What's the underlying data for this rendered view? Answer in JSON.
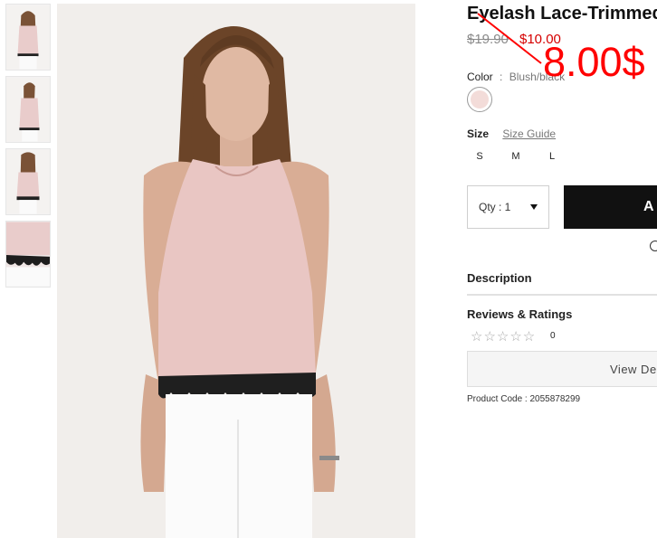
{
  "gallery": {
    "thumbnails": [
      {
        "icon": "product-front-thumbnail"
      },
      {
        "icon": "product-side-thumbnail"
      },
      {
        "icon": "product-back-thumbnail"
      },
      {
        "icon": "product-lace-detail-thumbnail"
      }
    ],
    "main_image_icon": "product-model-photo"
  },
  "product": {
    "title": "Eyelash Lace-Trimmed",
    "price_original": "$19.90",
    "price_sale": "$10.00",
    "annotation_price": "8.00$",
    "color_label": "Color",
    "color_separator": ":",
    "color_value": "Blush/black",
    "size_label": "Size",
    "size_guide": "Size Guide",
    "sizes": [
      "S",
      "M",
      "L"
    ],
    "qty_label": "Qty : 1",
    "add_button": "A",
    "description_label": "Description",
    "reviews_label": "Reviews & Ratings",
    "stars": "☆☆☆☆☆",
    "review_count": "0",
    "view_button": "View De",
    "product_code": "Product Code : 2055878299"
  },
  "colors": {
    "sale_red": "#d50000",
    "annotation_red": "#ff0000",
    "swatch_blush": "#f3dcd9",
    "button_black": "#111111"
  }
}
